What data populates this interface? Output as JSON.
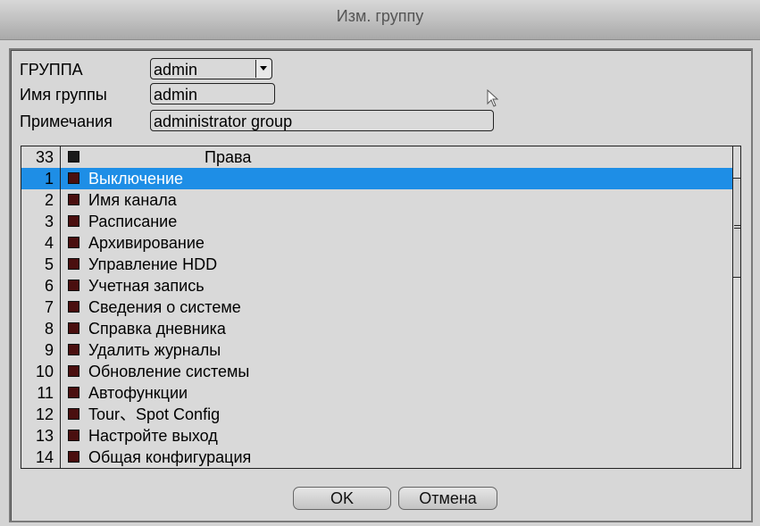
{
  "window": {
    "title": "Изм. группу"
  },
  "form": {
    "group_label": "ГРУППА",
    "group_value": "admin",
    "group_name_label": "Имя группы",
    "group_name_value": "admin",
    "notes_label": "Примечания",
    "notes_value": "administrator group"
  },
  "rights": {
    "header_count": "33",
    "header_title": "Права",
    "selected_index": 0,
    "rows": [
      {
        "num": "1",
        "label": "Выключение"
      },
      {
        "num": "2",
        "label": "Имя канала"
      },
      {
        "num": "3",
        "label": "Расписание"
      },
      {
        "num": "4",
        "label": "Архивирование"
      },
      {
        "num": "5",
        "label": "Управление HDD"
      },
      {
        "num": "6",
        "label": "Учетная запись"
      },
      {
        "num": "7",
        "label": "Сведения о системе"
      },
      {
        "num": "8",
        "label": "Справка дневника"
      },
      {
        "num": "9",
        "label": "Удалить журналы"
      },
      {
        "num": "10",
        "label": "Обновление системы"
      },
      {
        "num": "11",
        "label": "Автофункции"
      },
      {
        "num": "12",
        "label": "Tour、Spot Config"
      },
      {
        "num": "13",
        "label": "Настройте выход"
      },
      {
        "num": "14",
        "label": "Общая конфигурация"
      }
    ]
  },
  "buttons": {
    "ok_label": "OK",
    "cancel_label": "Отмена"
  },
  "colors": {
    "selection": "#1e8ee6",
    "checkbox": "#4a0f0f"
  },
  "icons": {
    "cursor": "mouse-pointer-icon",
    "dropdown": "chevron-down-icon"
  }
}
